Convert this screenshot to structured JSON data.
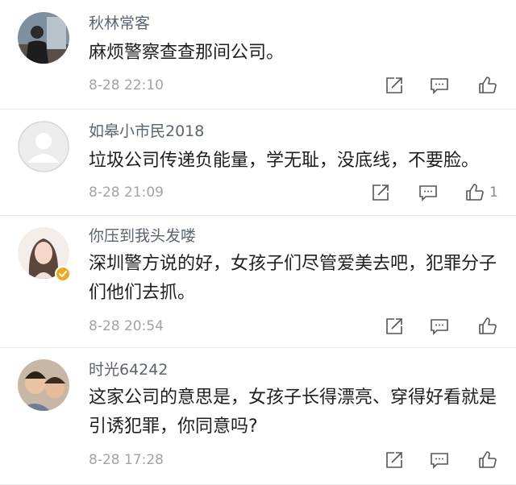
{
  "comments": [
    {
      "username": "秋林常客",
      "text": "麻烦警察查查那间公司。",
      "time": "8-28 22:10",
      "likes": ""
    },
    {
      "username": "如皋小市民2018",
      "text": "垃圾公司传递负能量，学无耻，没底线，不要脸。",
      "time": "8-28 21:09",
      "likes": "1"
    },
    {
      "username": "你压到我头发喽",
      "text": "深圳警方说的好，女孩子们尽管爱美去吧，犯罪分子们他们去抓。",
      "time": "8-28 20:54",
      "likes": ""
    },
    {
      "username": "时光64242",
      "text": "这家公司的意思是，女孩子长得漂亮、穿得好看就是引诱犯罪，你同意吗?",
      "time": "8-28 17:28",
      "likes": ""
    }
  ],
  "icons": {
    "share": "share-icon",
    "reply": "comment-icon",
    "like": "thumbs-up-icon"
  },
  "colors": {
    "username": "#5b6472",
    "text": "#1e1e1e",
    "meta": "#a3a3a3",
    "verified_badge": "#f0a81d"
  }
}
